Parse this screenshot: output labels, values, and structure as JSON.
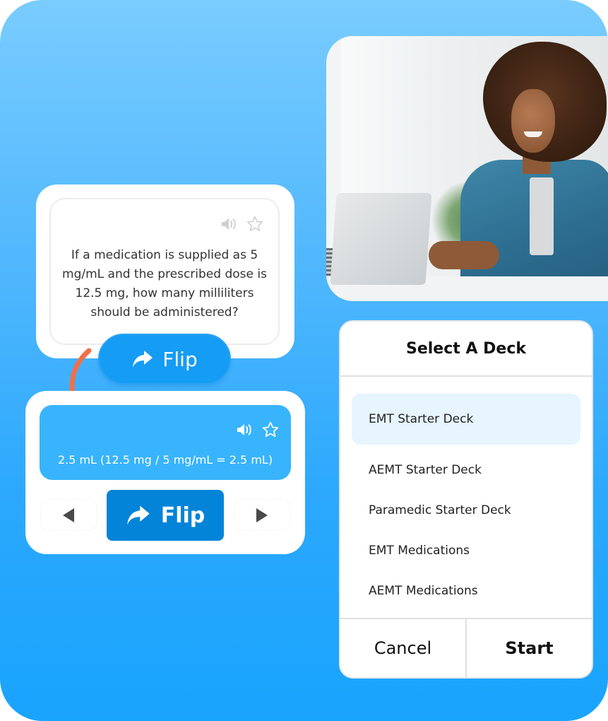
{
  "colors": {
    "background_top": "#79ccfe",
    "background_bottom": "#19a4fd",
    "flip_pill": "#159cf4",
    "answer_card": "#38b4fd",
    "flip_button": "#0384d8",
    "selected_deck": "#e6f5fe",
    "arrow": "#f0704a"
  },
  "question_card": {
    "icons": [
      "speaker-icon",
      "star-icon"
    ],
    "question": "If a medication is supplied as 5 mg/mL and the prescribed dose is 12.5 mg, how many milliliters should be administered?",
    "flip_label": "Flip"
  },
  "answer_card": {
    "icons": [
      "speaker-icon",
      "star-icon"
    ],
    "answer": "2.5 mL (12.5 mg / 5 mg/mL = 2.5 mL)",
    "flip_label": "Flip",
    "prev_icon": "triangle-left-icon",
    "next_icon": "triangle-right-icon"
  },
  "photo": {
    "description": "Smiling woman in denim jacket typing on a laptop"
  },
  "deck_dialog": {
    "title": "Select A Deck",
    "items": [
      {
        "label": "EMT Starter Deck",
        "selected": true
      },
      {
        "label": "AEMT Starter Deck",
        "selected": false
      },
      {
        "label": "Paramedic Starter Deck",
        "selected": false
      },
      {
        "label": "EMT Medications",
        "selected": false
      },
      {
        "label": "AEMT Medications",
        "selected": false
      }
    ],
    "cancel_label": "Cancel",
    "start_label": "Start"
  }
}
